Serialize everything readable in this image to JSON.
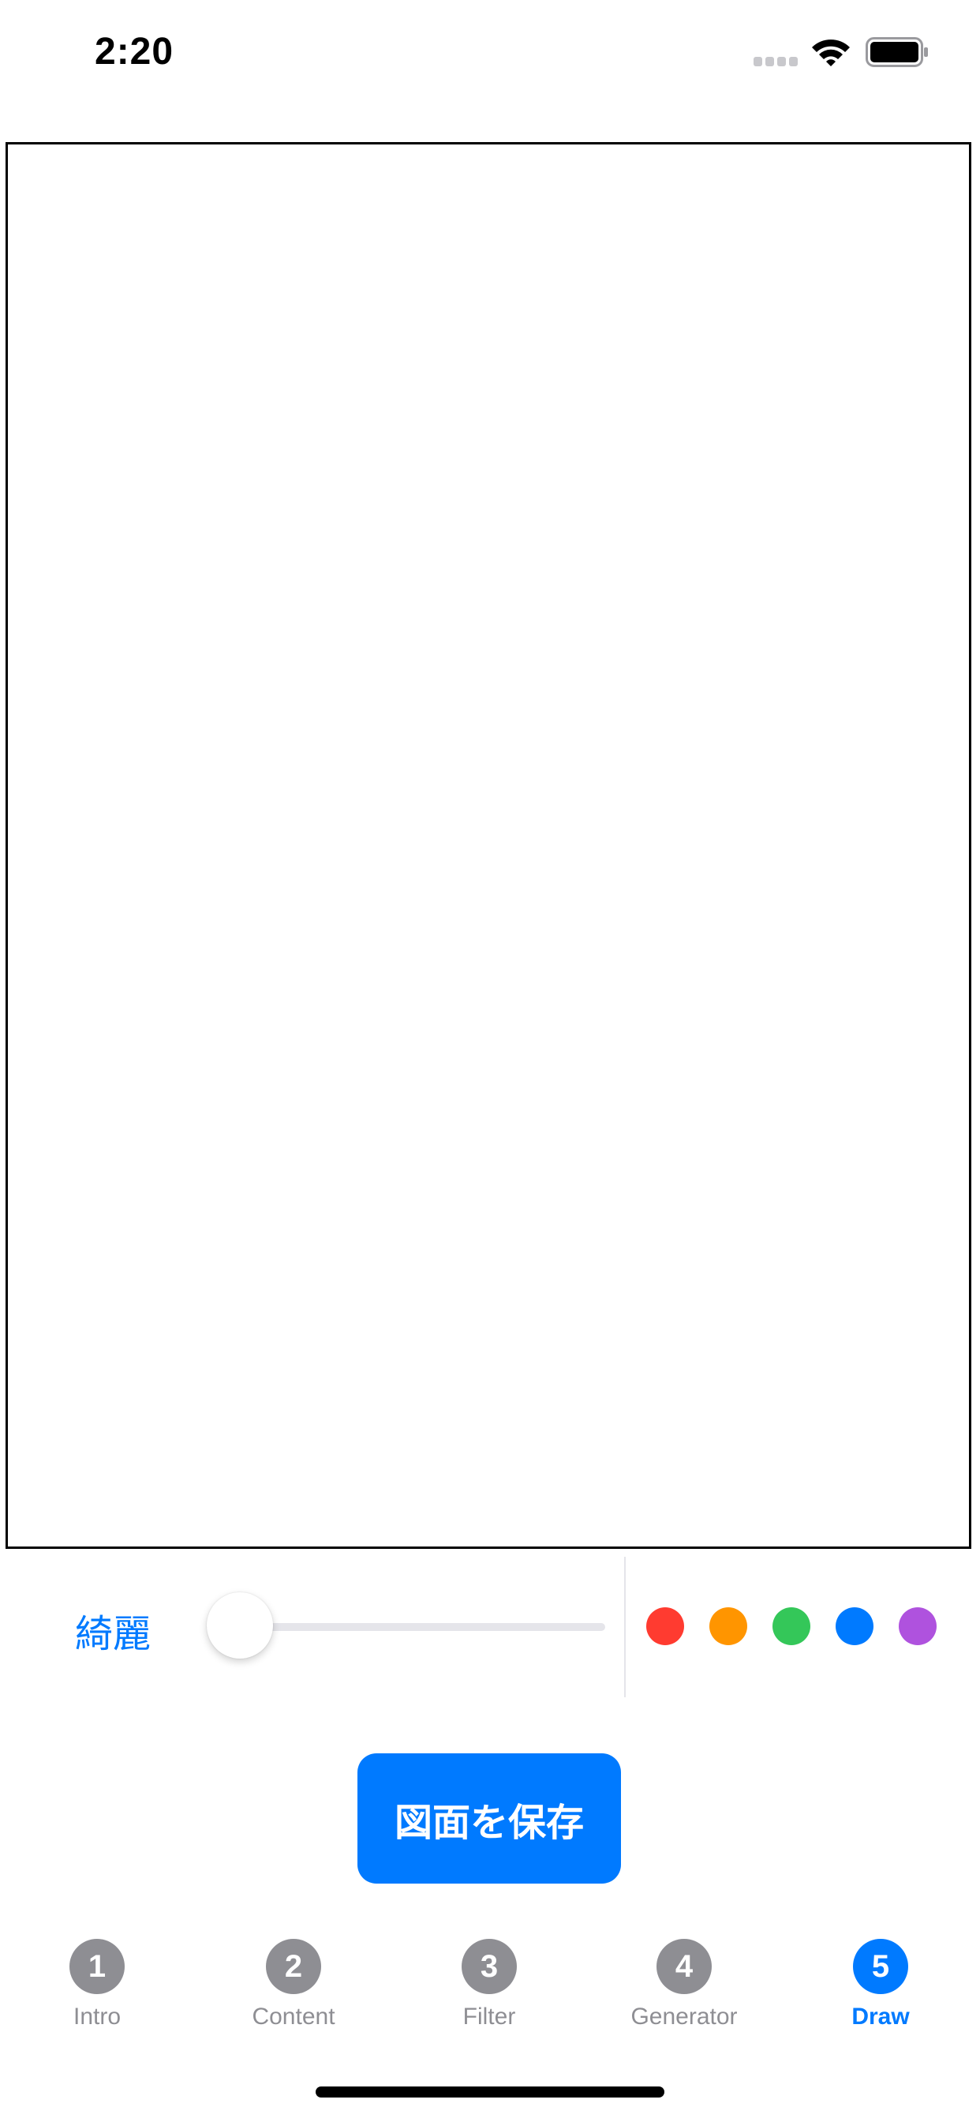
{
  "status_bar": {
    "time": "2:20",
    "icons": [
      "signal-icon",
      "wifi-icon",
      "battery-icon"
    ]
  },
  "toolbar": {
    "smooth_label": "綺麗",
    "line_width_slider": {
      "value_fraction": 0.0
    },
    "colors": [
      {
        "name": "red",
        "hex": "#ff3b30"
      },
      {
        "name": "orange",
        "hex": "#ff9500"
      },
      {
        "name": "green",
        "hex": "#34c759"
      },
      {
        "name": "blue",
        "hex": "#007aff"
      },
      {
        "name": "purple",
        "hex": "#af52de"
      }
    ]
  },
  "save_button": {
    "label": "図面を保存"
  },
  "tabs": [
    {
      "number": "1",
      "label": "Intro",
      "active": false
    },
    {
      "number": "2",
      "label": "Content",
      "active": false
    },
    {
      "number": "3",
      "label": "Filter",
      "active": false
    },
    {
      "number": "4",
      "label": "Generator",
      "active": false
    },
    {
      "number": "5",
      "label": "Draw",
      "active": true
    }
  ],
  "theme": {
    "accent": "#007aff",
    "inactive": "#8e8e93",
    "track": "#e5e5ea"
  }
}
